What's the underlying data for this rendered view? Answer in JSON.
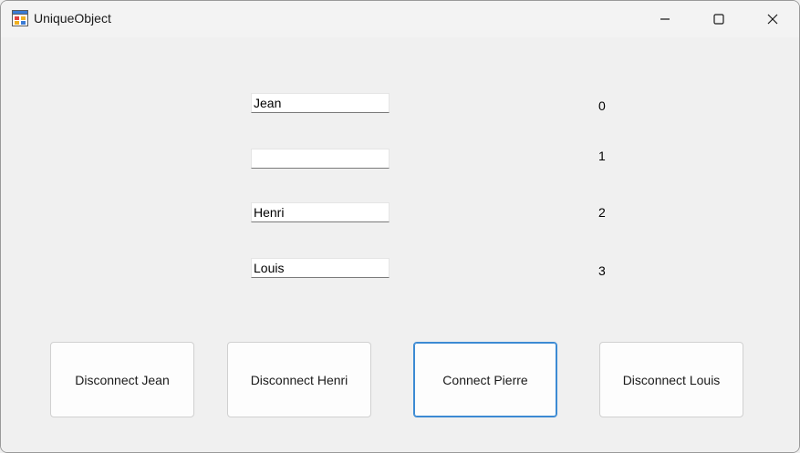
{
  "window": {
    "title": "UniqueObject"
  },
  "icons": {
    "app": "app-form-icon",
    "minimize": "minimize-icon",
    "maximize": "maximize-icon",
    "close": "close-icon"
  },
  "fields": [
    {
      "value": "Jean",
      "label": "0"
    },
    {
      "value": "",
      "label": "1"
    },
    {
      "value": "Henri",
      "label": "2"
    },
    {
      "value": "Louis",
      "label": "3"
    }
  ],
  "buttons": [
    {
      "label": "Disconnect Jean"
    },
    {
      "label": "Disconnect Henri"
    },
    {
      "label": "Connect Pierre"
    },
    {
      "label": "Disconnect Louis"
    }
  ],
  "colors": {
    "focus_border": "#3c8ad3",
    "window_bg": "#f0f0f0"
  }
}
